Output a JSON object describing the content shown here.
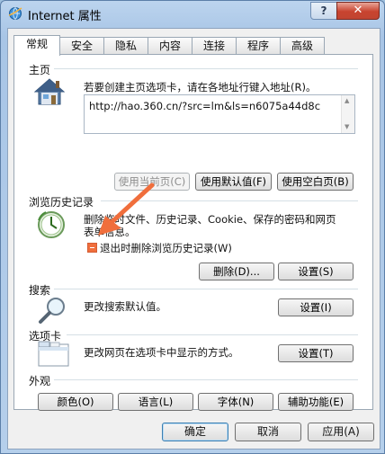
{
  "window": {
    "title": "Internet 属性",
    "help_label": "?",
    "close_label": "✕"
  },
  "tabs": [
    "常规",
    "安全",
    "隐私",
    "内容",
    "连接",
    "程序",
    "高级"
  ],
  "homepage": {
    "label": "主页",
    "description": "若要创建主页选项卡，请在各地址行键入地址(R)。",
    "url": "http://hao.360.cn/?src=lm&ls=n6075a44d8c",
    "buttons": {
      "use_current": "使用当前页(C)",
      "use_default": "使用默认值(F)",
      "use_blank": "使用空白页(B)"
    }
  },
  "history": {
    "label": "浏览历史记录",
    "description_line1": "删除临时文件、历史记录、Cookie、保存的密码和网页",
    "description_line2": "表单信息。",
    "checkbox_label": "退出时删除浏览历史记录(W)",
    "delete_button": "删除(D)...",
    "settings_button": "设置(S)"
  },
  "search": {
    "label": "搜索",
    "description": "更改搜索默认值。",
    "settings_button": "设置(I)"
  },
  "tabs_group": {
    "label": "选项卡",
    "description": "更改网页在选项卡中显示的方式。",
    "settings_button": "设置(T)"
  },
  "appearance": {
    "label": "外观",
    "colors": "颜色(O)",
    "languages": "语言(L)",
    "fonts": "字体(N)",
    "accessibility": "辅助功能(E)"
  },
  "footer": {
    "ok": "确定",
    "cancel": "取消",
    "apply": "应用(A)"
  },
  "colors": {
    "accent_orange": "#f06e3c",
    "titlebar": "#bcd4ee",
    "close_red": "#c8432f"
  }
}
